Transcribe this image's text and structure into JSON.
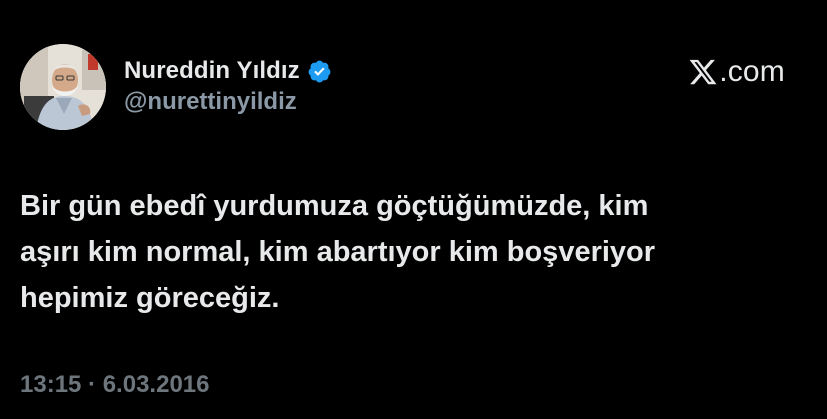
{
  "author": {
    "display_name": "Nureddin Yıldız",
    "handle": "@nurettinyildiz",
    "verified": true,
    "avatar_icon": "avatar-photo"
  },
  "brand": {
    "icon": "x-logo-icon",
    "suffix": ".com"
  },
  "tweet": {
    "lines": [
      "Bir gün ebedî yurdumuza göçtüğümüzde, kim",
      "aşırı kim normal, kim abartıyor kim boşveriyor",
      "hepimiz göreceğiz."
    ]
  },
  "meta": {
    "timestamp": "13:15 · 6.03.2016"
  },
  "colors": {
    "background": "#000000",
    "primary_text": "#e7e9ea",
    "secondary_text": "#8b98a5",
    "verified_blue": "#1d9bf0"
  }
}
